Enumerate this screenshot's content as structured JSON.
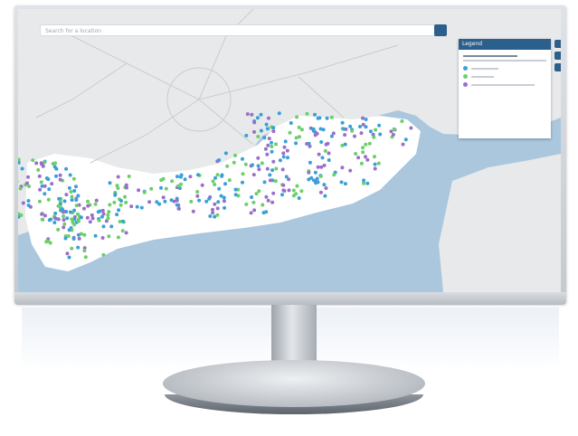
{
  "map": {
    "land_color": "#e8e9ea",
    "sea_color": "#aac7de",
    "region_color": "#ffffff",
    "search_placeholder": "Search for a location"
  },
  "legend": {
    "title": "Legend",
    "accent": "#2b5f8c",
    "marker_colors": [
      "#3aa0d8",
      "#6ccf6a",
      "#9b6fc9"
    ]
  },
  "icons": {
    "search": "search-icon",
    "legend_toggle": "chevron-icon",
    "zoom_in": "plus-icon",
    "zoom_out": "minus-icon"
  }
}
